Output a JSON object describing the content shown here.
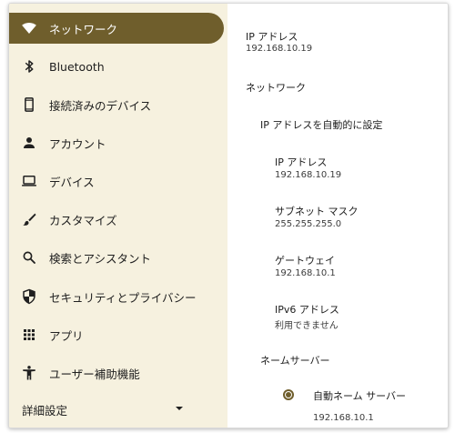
{
  "colors": {
    "accent": "#6f5e2c",
    "sidebar_bg": "#f6f1df"
  },
  "sidebar": {
    "items": [
      {
        "label": "ネットワーク",
        "icon": "wifi-icon",
        "active": true
      },
      {
        "label": "Bluetooth",
        "icon": "bluetooth-icon"
      },
      {
        "label": "接続済みのデバイス",
        "icon": "phone-icon"
      },
      {
        "label": "アカウント",
        "icon": "person-icon"
      },
      {
        "label": "デバイス",
        "icon": "laptop-icon"
      },
      {
        "label": "カスタマイズ",
        "icon": "brush-icon"
      },
      {
        "label": "検索とアシスタント",
        "icon": "search-icon"
      },
      {
        "label": "セキュリティとプライバシー",
        "icon": "shield-icon"
      },
      {
        "label": "アプリ",
        "icon": "apps-grid-icon"
      },
      {
        "label": "ユーザー補助機能",
        "icon": "accessibility-icon"
      }
    ],
    "advanced": {
      "label": "詳細設定",
      "icon": "chevron-down-icon"
    }
  },
  "content": {
    "ip_header": {
      "label": "IP アドレス",
      "value": "192.168.10.19"
    },
    "network_section": "ネットワーク",
    "auto_ip": "IP アドレスを自動的に設定",
    "fields": [
      {
        "label": "IP アドレス",
        "value": "192.168.10.19"
      },
      {
        "label": "サブネット マスク",
        "value": "255.255.255.0"
      },
      {
        "label": "ゲートウェイ",
        "value": "192.168.10.1"
      },
      {
        "label": "IPv6 アドレス",
        "value": "利用できません"
      }
    ],
    "nameserver": {
      "label": "ネームサーバー",
      "option_label": "自動ネーム サーバー",
      "selected": true,
      "value": "192.168.10.1"
    }
  }
}
